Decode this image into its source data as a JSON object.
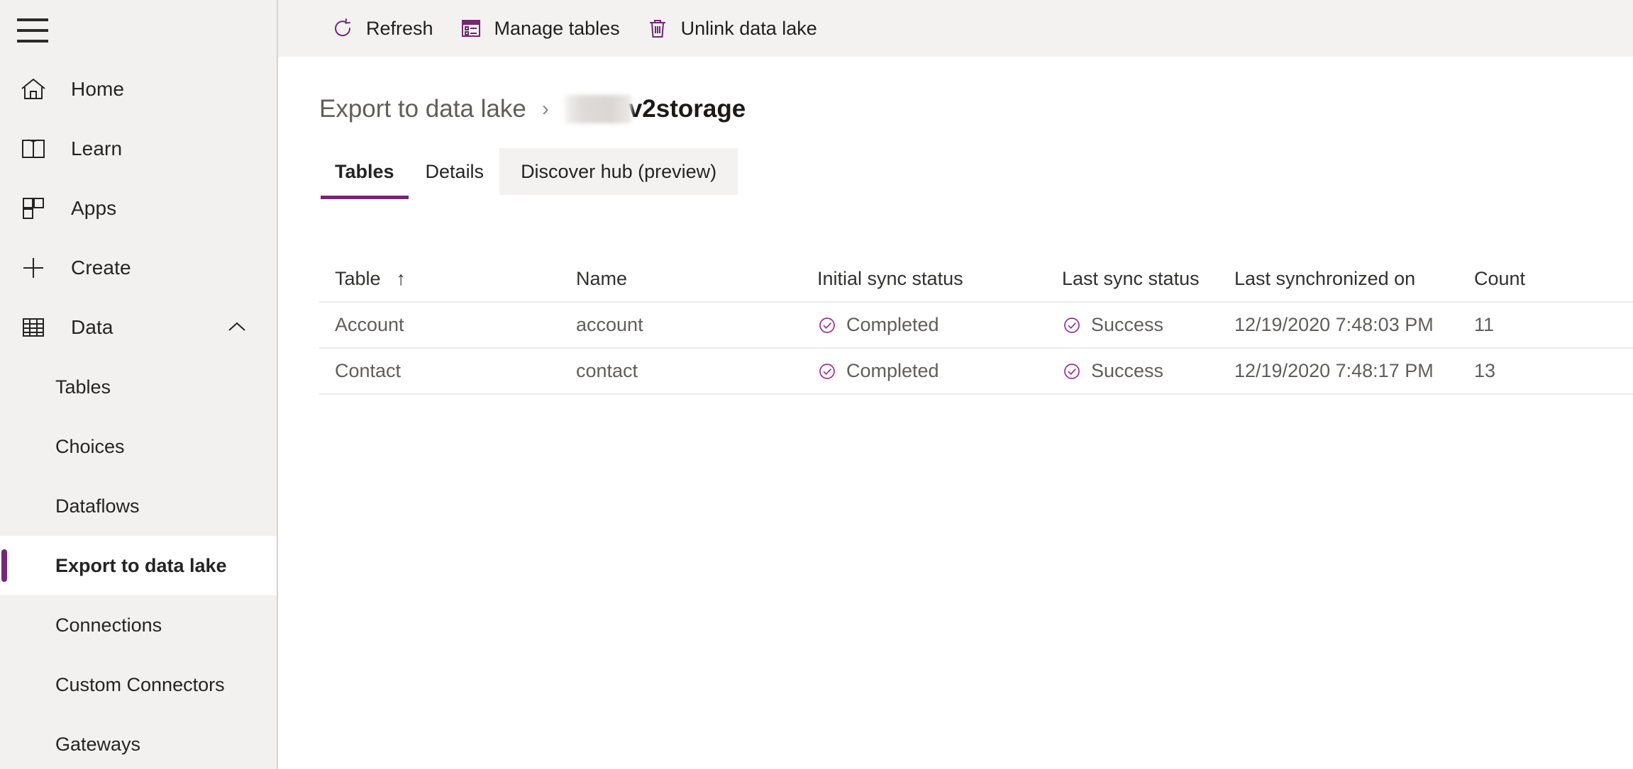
{
  "colors": {
    "accent_purple": "#742774",
    "sidebar_bg": "#f2f1f0",
    "commandbar_bg": "#f3f2f1",
    "divider": "#edebe9",
    "text_primary": "#242424",
    "text_secondary": "#605e5c"
  },
  "sidebar": {
    "menu_button": "menu-icon",
    "items": [
      {
        "label": "Home",
        "icon": "home-icon",
        "type": "top"
      },
      {
        "label": "Learn",
        "icon": "book-icon",
        "type": "top"
      },
      {
        "label": "Apps",
        "icon": "apps-icon",
        "type": "top"
      },
      {
        "label": "Create",
        "icon": "plus-icon",
        "type": "top"
      },
      {
        "label": "Data",
        "icon": "table-grid-icon",
        "type": "group",
        "expanded": true,
        "chevron": "chevron-up-icon"
      }
    ],
    "sub_items": [
      {
        "label": "Tables",
        "selected": false
      },
      {
        "label": "Choices",
        "selected": false
      },
      {
        "label": "Dataflows",
        "selected": false
      },
      {
        "label": "Export to data lake",
        "selected": true
      },
      {
        "label": "Connections",
        "selected": false
      },
      {
        "label": "Custom Connectors",
        "selected": false
      },
      {
        "label": "Gateways",
        "selected": false
      }
    ]
  },
  "commandbar": {
    "buttons": [
      {
        "label": "Refresh",
        "icon": "refresh-icon"
      },
      {
        "label": "Manage tables",
        "icon": "manage-tables-icon"
      },
      {
        "label": "Unlink data lake",
        "icon": "trash-icon"
      }
    ]
  },
  "breadcrumb": {
    "root": "Export to data lake",
    "separator": "›",
    "redacted": "",
    "current": "v2storage"
  },
  "tabs": [
    {
      "label": "Tables",
      "active": true,
      "hovered": false
    },
    {
      "label": "Details",
      "active": false,
      "hovered": false
    },
    {
      "label": "Discover hub (preview)",
      "active": false,
      "hovered": true
    }
  ],
  "grid": {
    "columns": [
      {
        "key": "table",
        "label": "Table",
        "sorted": "asc",
        "sort_glyph": "↑"
      },
      {
        "key": "name",
        "label": "Name",
        "sorted": "",
        "sort_glyph": ""
      },
      {
        "key": "init",
        "label": "Initial sync status",
        "sorted": "",
        "sort_glyph": ""
      },
      {
        "key": "last",
        "label": "Last sync status",
        "sorted": "",
        "sort_glyph": ""
      },
      {
        "key": "sync",
        "label": "Last synchronized on",
        "sorted": "",
        "sort_glyph": ""
      },
      {
        "key": "count",
        "label": "Count",
        "sorted": "",
        "sort_glyph": ""
      }
    ],
    "rows": [
      {
        "table": "Account",
        "name": "account",
        "init": "Completed",
        "init_icon": "check-circle-icon",
        "last": "Success",
        "last_icon": "check-circle-icon",
        "sync": "12/19/2020 7:48:03 PM",
        "count": "11"
      },
      {
        "table": "Contact",
        "name": "contact",
        "init": "Completed",
        "init_icon": "check-circle-icon",
        "last": "Success",
        "last_icon": "check-circle-icon",
        "sync": "12/19/2020 7:48:17 PM",
        "count": "13"
      }
    ]
  }
}
